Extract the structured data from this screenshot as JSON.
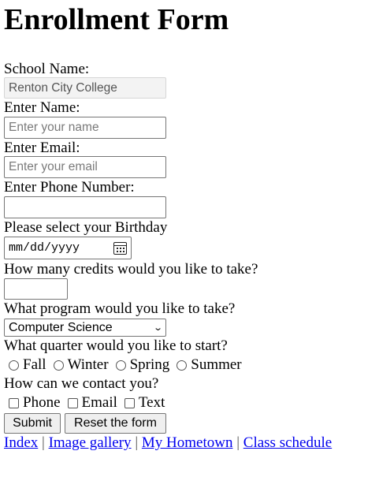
{
  "form": {
    "title": "Enrollment Form",
    "school_label": "School Name:",
    "school_value": "Renton City College",
    "name_label": "Enter Name:",
    "name_placeholder": "Enter your name",
    "email_label": "Enter Email:",
    "email_placeholder": "Enter your email",
    "phone_label": "Enter Phone Number:",
    "birthday_label": "Please select your Birthday",
    "birthday_placeholder": "mm/dd/yyyy",
    "credits_label": "How many credits would you like to take?",
    "program_label": "What program would you like to take?",
    "program_value": "Computer Science",
    "quarter_label": "What quarter would you like to start?",
    "quarters": [
      "Fall",
      "Winter",
      "Spring",
      "Summer"
    ],
    "contact_label": "How can we contact you?",
    "contacts": [
      "Phone",
      "Email",
      "Text"
    ],
    "submit_label": "Submit",
    "reset_label": "Reset the form"
  },
  "links": [
    "Index",
    "Image gallery",
    "My Hometown",
    "Class schedule"
  ],
  "link_separator": "|"
}
